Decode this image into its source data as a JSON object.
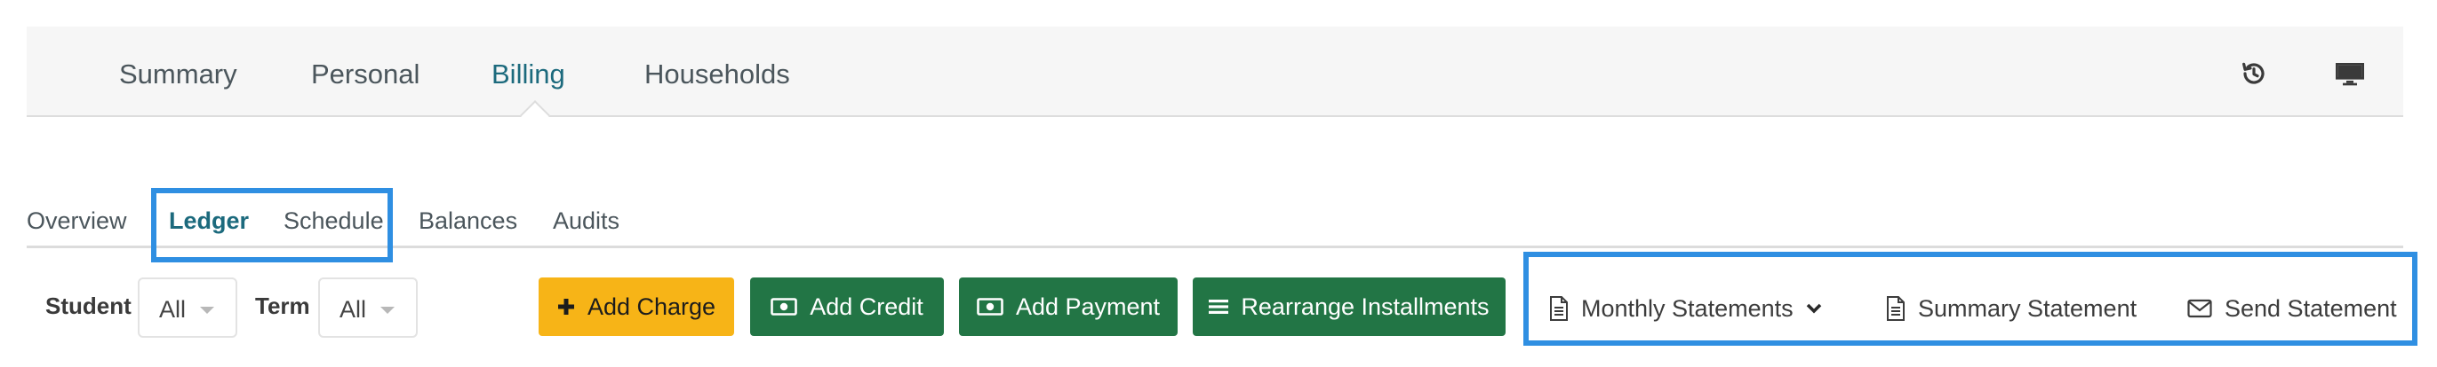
{
  "top_nav": {
    "tabs": [
      {
        "label": "Summary"
      },
      {
        "label": "Personal"
      },
      {
        "label": "Billing",
        "active": true
      },
      {
        "label": "Households"
      }
    ],
    "icons": [
      "history-icon",
      "desktop-icon"
    ]
  },
  "sub_tabs": [
    {
      "label": "Overview"
    },
    {
      "label": "Ledger",
      "active": true
    },
    {
      "label": "Schedule"
    },
    {
      "label": "Balances"
    },
    {
      "label": "Audits"
    }
  ],
  "filters": {
    "student_label": "Student",
    "student_value": "All",
    "term_label": "Term",
    "term_value": "All"
  },
  "actions": {
    "add_charge": "Add Charge",
    "add_credit": "Add Credit",
    "add_payment": "Add Payment",
    "rearrange": "Rearrange Installments"
  },
  "statements": {
    "monthly": "Monthly Statements",
    "summary": "Summary Statement",
    "send": "Send Statement"
  },
  "colors": {
    "accent_teal": "#1c6a7d",
    "button_green": "#227545",
    "button_yellow": "#f7b417",
    "highlight_blue": "#2f8fe2"
  }
}
